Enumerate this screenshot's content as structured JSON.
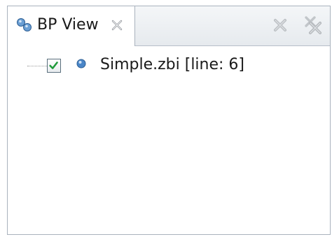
{
  "view": {
    "tab_title": "BP View",
    "tab_icon": "breakpoints-view-icon",
    "close_icon": "close-tab-icon"
  },
  "toolbar": {
    "remove_selected_icon": "remove-selected-breakpoint-icon",
    "remove_all_icon": "remove-all-breakpoints-icon"
  },
  "breakpoints": [
    {
      "label": "Simple.zbi [line: 6]",
      "enabled": true,
      "icon": "breakpoint-dot-icon"
    }
  ],
  "colors": {
    "checkmark": "#1e9a3a",
    "breakpoint_dot": "#4a86c8",
    "disabled_icon": "#b8bcc0"
  }
}
